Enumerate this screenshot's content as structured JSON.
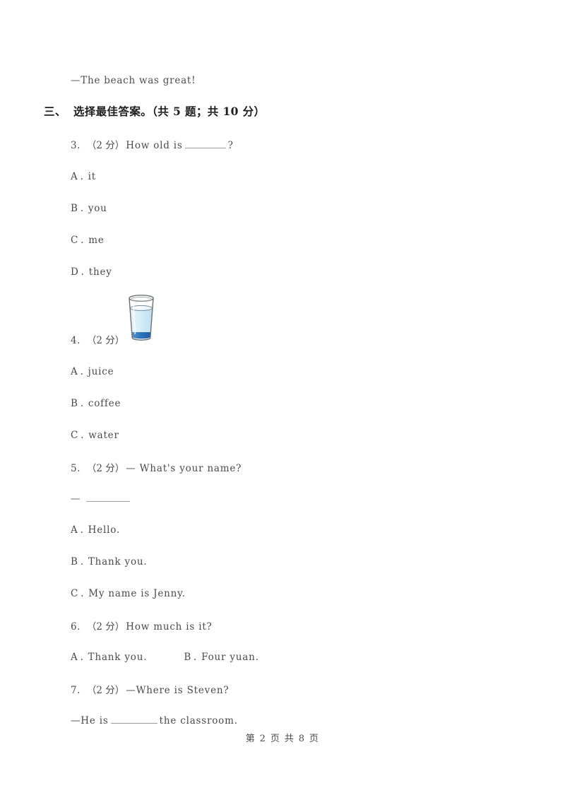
{
  "document": {
    "carry_over_line": "—The beach was great!",
    "footer": "第 2 页 共 8 页"
  },
  "section": {
    "number": "三、",
    "title": "选择最佳答案。",
    "meta": "（共 5 题；共 10 分）"
  },
  "questions": [
    {
      "number": "3.",
      "score": "（2 分）",
      "stem_before_blank": "How old is",
      "stem_after_blank": "?",
      "options": [
        {
          "label": "A",
          "dot": ".",
          "text": "it"
        },
        {
          "label": "B",
          "dot": ".",
          "text": "you"
        },
        {
          "label": "C",
          "dot": ".",
          "text": "me"
        },
        {
          "label": "D",
          "dot": ".",
          "text": "they"
        }
      ]
    },
    {
      "number": "4.",
      "score": "（2 分）",
      "stem_before_blank": "",
      "stem_after_blank": "",
      "image_alt": "glass-of-water-icon",
      "options": [
        {
          "label": "A",
          "dot": ".",
          "text": "juice"
        },
        {
          "label": "B",
          "dot": ".",
          "text": "coffee"
        },
        {
          "label": "C",
          "dot": ".",
          "text": "water"
        }
      ]
    },
    {
      "number": "5.",
      "score": "（2 分）",
      "stem_before_blank": "— What's your name?",
      "answer_dash": "—",
      "options": [
        {
          "label": "A",
          "dot": ".",
          "text": "Hello."
        },
        {
          "label": "B",
          "dot": ".",
          "text": "Thank you."
        },
        {
          "label": "C",
          "dot": ".",
          "text": "My name is Jenny."
        }
      ]
    },
    {
      "number": "6.",
      "score": "（2 分）",
      "stem_before_blank": "How much is it?",
      "options": [
        {
          "label": "A",
          "dot": ".",
          "text": "Thank you."
        },
        {
          "label": "B",
          "dot": ".",
          "text": "Four yuan."
        }
      ]
    },
    {
      "number": "7.",
      "score": "（2 分）",
      "stem_before_blank": "—Where is Steven?",
      "answer_prefix": "—He is",
      "answer_suffix": "the classroom."
    }
  ],
  "colors": {
    "page_background": "#ffffff",
    "body_text": "#4a4a4a",
    "heading_text": "#1d1d1d",
    "blank_rule": "#9a9a9a",
    "water_light": "#cfe8f5",
    "water_deep": "#2f7bc4",
    "glass_outline": "#6e6e6e"
  }
}
